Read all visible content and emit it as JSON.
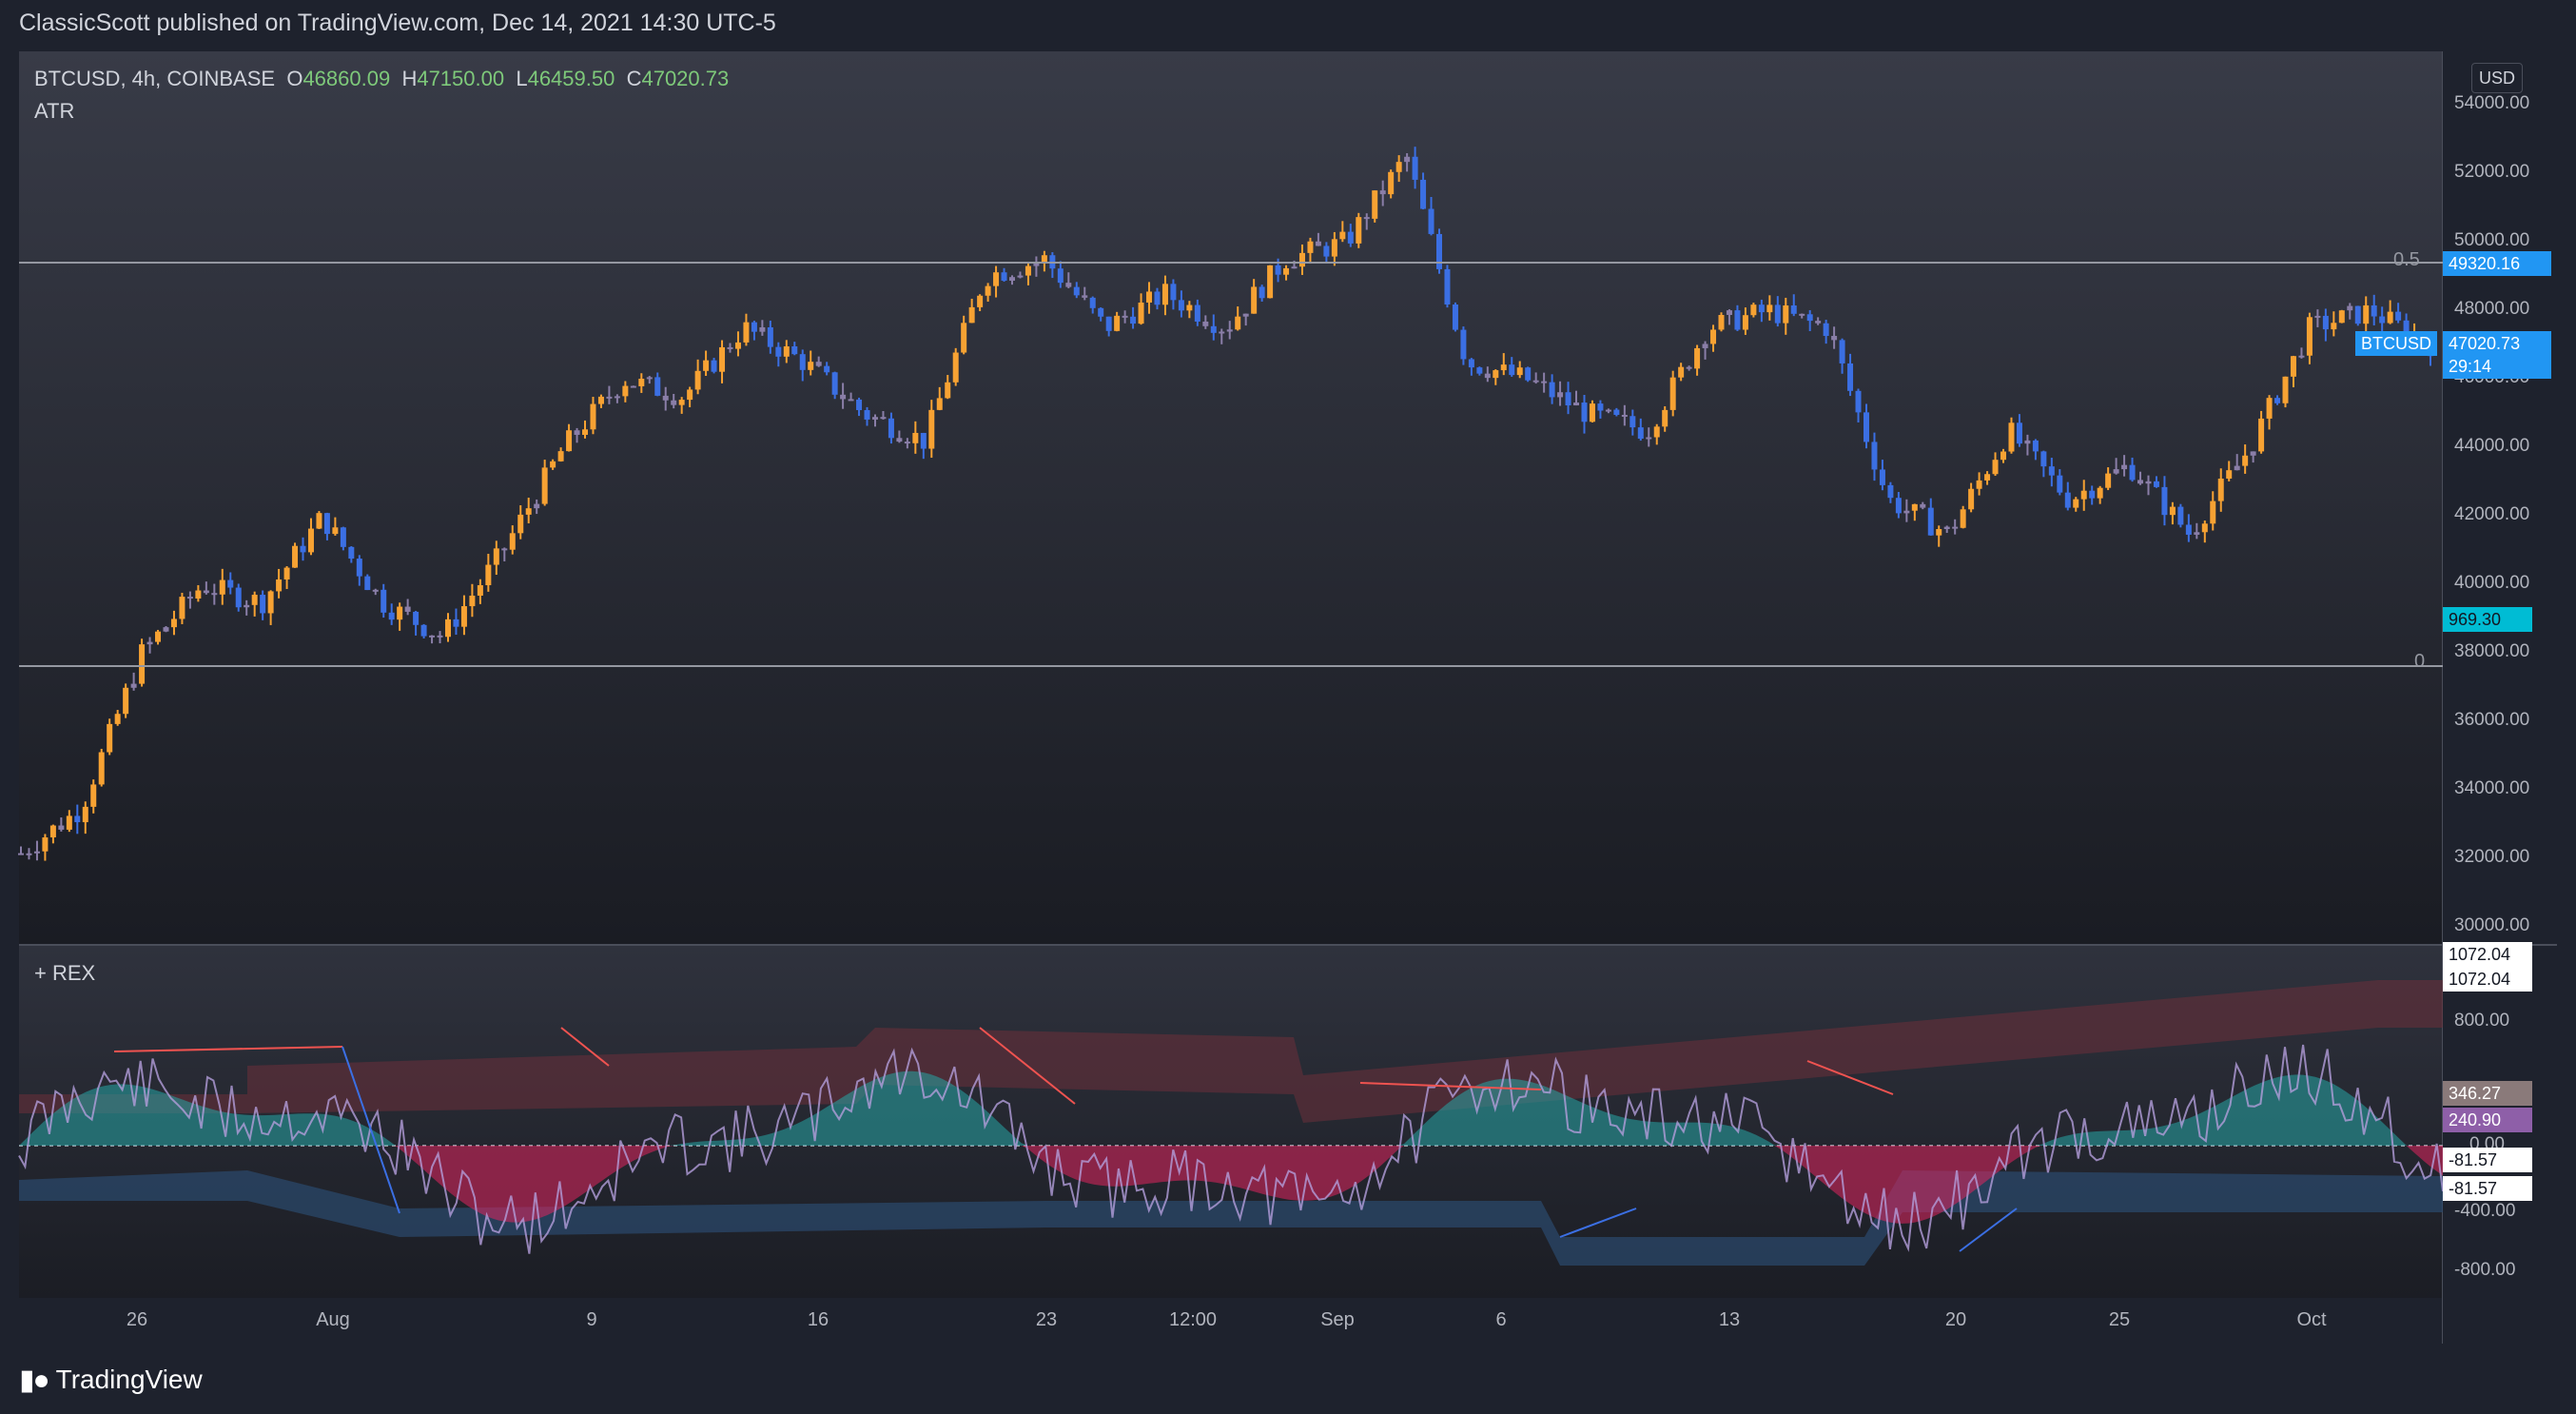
{
  "header": {
    "published": "ClassicScott published on TradingView.com, Dec 14, 2021 14:30 UTC-5"
  },
  "legend": {
    "symbol": "BTCUSD, 4h, COINBASE",
    "o_key": "O",
    "o_val": "46860.09",
    "h_key": "H",
    "h_val": "47150.00",
    "l_key": "L",
    "l_val": "46459.50",
    "c_key": "C",
    "c_val": "47020.73",
    "study": "ATR"
  },
  "currency_button": "USD",
  "price_axis": {
    "labels": [
      "54000.00",
      "52000.00",
      "50000.00",
      "48000.00",
      "46000.00",
      "44000.00",
      "42000.00",
      "40000.00",
      "38000.00",
      "36000.00",
      "34000.00",
      "32000.00",
      "30000.00"
    ]
  },
  "levels": {
    "upper_value": "49320.16",
    "upper_text": "0.5",
    "lower_text": "0",
    "atr_value": "969.30",
    "symbol_tag": "BTCUSD",
    "last_price": "47020.73",
    "countdown": "29:14"
  },
  "indicator": {
    "title": "+ REX",
    "axis_labels": [
      "800.00",
      "0.00",
      "-400.00",
      "-800.00"
    ],
    "value_tags": [
      "1072.04",
      "1072.04",
      "346.27",
      "240.90",
      "-81.57",
      "-81.57"
    ]
  },
  "time_axis": {
    "labels": [
      "26",
      "Aug",
      "9",
      "16",
      "23",
      "12:00",
      "Sep",
      "6",
      "13",
      "20",
      "25",
      "Oct"
    ]
  },
  "footer": {
    "brand": "TradingView"
  },
  "colors": {
    "up_candle": "#f7a233",
    "down_candle": "#3b6fe3",
    "neutral_candle": "#8a7ea8",
    "bullish_fill": "#26a6a6",
    "bearish_fill": "#e0245e",
    "atr_tag": "#00bcd4",
    "price_tag": "#2196f3"
  },
  "chart_data": {
    "type": "candlestick",
    "timeframe": "4h",
    "y_range": [
      30000,
      55000
    ],
    "close_path": [
      [
        "Jul 22",
        32200
      ],
      [
        "Jul 24",
        33500
      ],
      [
        "Jul 26",
        38000
      ],
      [
        "Jul 28",
        40000
      ],
      [
        "Jul 30",
        39500
      ],
      [
        "Aug 1",
        42000
      ],
      [
        "Aug 3",
        39500
      ],
      [
        "Aug 5",
        38500
      ],
      [
        "Aug 7",
        41000
      ],
      [
        "Aug 9",
        44000
      ],
      [
        "Aug 11",
        46000
      ],
      [
        "Aug 13",
        45500
      ],
      [
        "Aug 15",
        47500
      ],
      [
        "Aug 17",
        46500
      ],
      [
        "Aug 19",
        45000
      ],
      [
        "Aug 21",
        44200
      ],
      [
        "Aug 23",
        49000
      ],
      [
        "Aug 25",
        49500
      ],
      [
        "Aug 27",
        47500
      ],
      [
        "Aug 29",
        48500
      ],
      [
        "Aug 31",
        47500
      ],
      [
        "Sep 2",
        49500
      ],
      [
        "Sep 4",
        50000
      ],
      [
        "Sep 6",
        52500
      ],
      [
        "Sep 7",
        46500
      ],
      [
        "Sep 9",
        46000
      ],
      [
        "Sep 11",
        45000
      ],
      [
        "Sep 13",
        44500
      ],
      [
        "Sep 15",
        47500
      ],
      [
        "Sep 17",
        48000
      ],
      [
        "Sep 19",
        47500
      ],
      [
        "Sep 21",
        42500
      ],
      [
        "Sep 22",
        41500
      ],
      [
        "Sep 24",
        44500
      ],
      [
        "Sep 25",
        42500
      ],
      [
        "Sep 27",
        43500
      ],
      [
        "Sep 29",
        41500
      ],
      [
        "Sep 30",
        44000
      ],
      [
        "Oct 2",
        47500
      ],
      [
        "Oct 4",
        48000
      ],
      [
        "Oct 5",
        47020
      ]
    ]
  }
}
